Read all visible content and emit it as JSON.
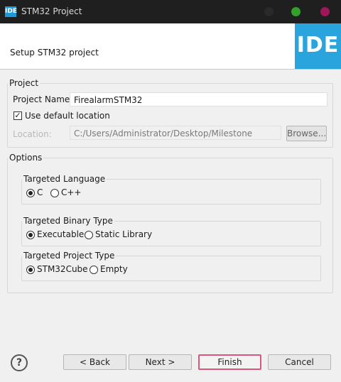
{
  "window": {
    "title": "STM32 Project",
    "app_icon_text": "IDE"
  },
  "banner": {
    "title": "Setup STM32 project",
    "logo_text": "IDE"
  },
  "project": {
    "legend": "Project",
    "name_label": "Project Name:",
    "name_value": "FirealarmSTM32",
    "use_default_label": "Use default location",
    "use_default_checked": true,
    "location_label": "Location:",
    "location_value": "C:/Users/Administrator/Desktop/Milestone",
    "browse_label": "Browse..."
  },
  "options": {
    "legend": "Options",
    "language": {
      "legend": "Targeted Language",
      "choices": [
        "C",
        "C++"
      ],
      "selected": "C"
    },
    "binary": {
      "legend": "Targeted Binary Type",
      "choices": [
        "Executable",
        "Static Library"
      ],
      "selected": "Executable"
    },
    "project_type": {
      "legend": "Targeted Project Type",
      "choices": [
        "STM32Cube",
        "Empty"
      ],
      "selected": "STM32Cube"
    }
  },
  "footer": {
    "help_icon": "?",
    "back_label": "< Back",
    "next_label": "Next >",
    "finish_label": "Finish",
    "cancel_label": "Cancel"
  },
  "colors": {
    "accent": "#2aa4dc",
    "titlebar": "#1f1f1f",
    "finish_border": "#d9577a",
    "maximize_dot": "#34a02c",
    "close_dot": "#a0165a"
  }
}
